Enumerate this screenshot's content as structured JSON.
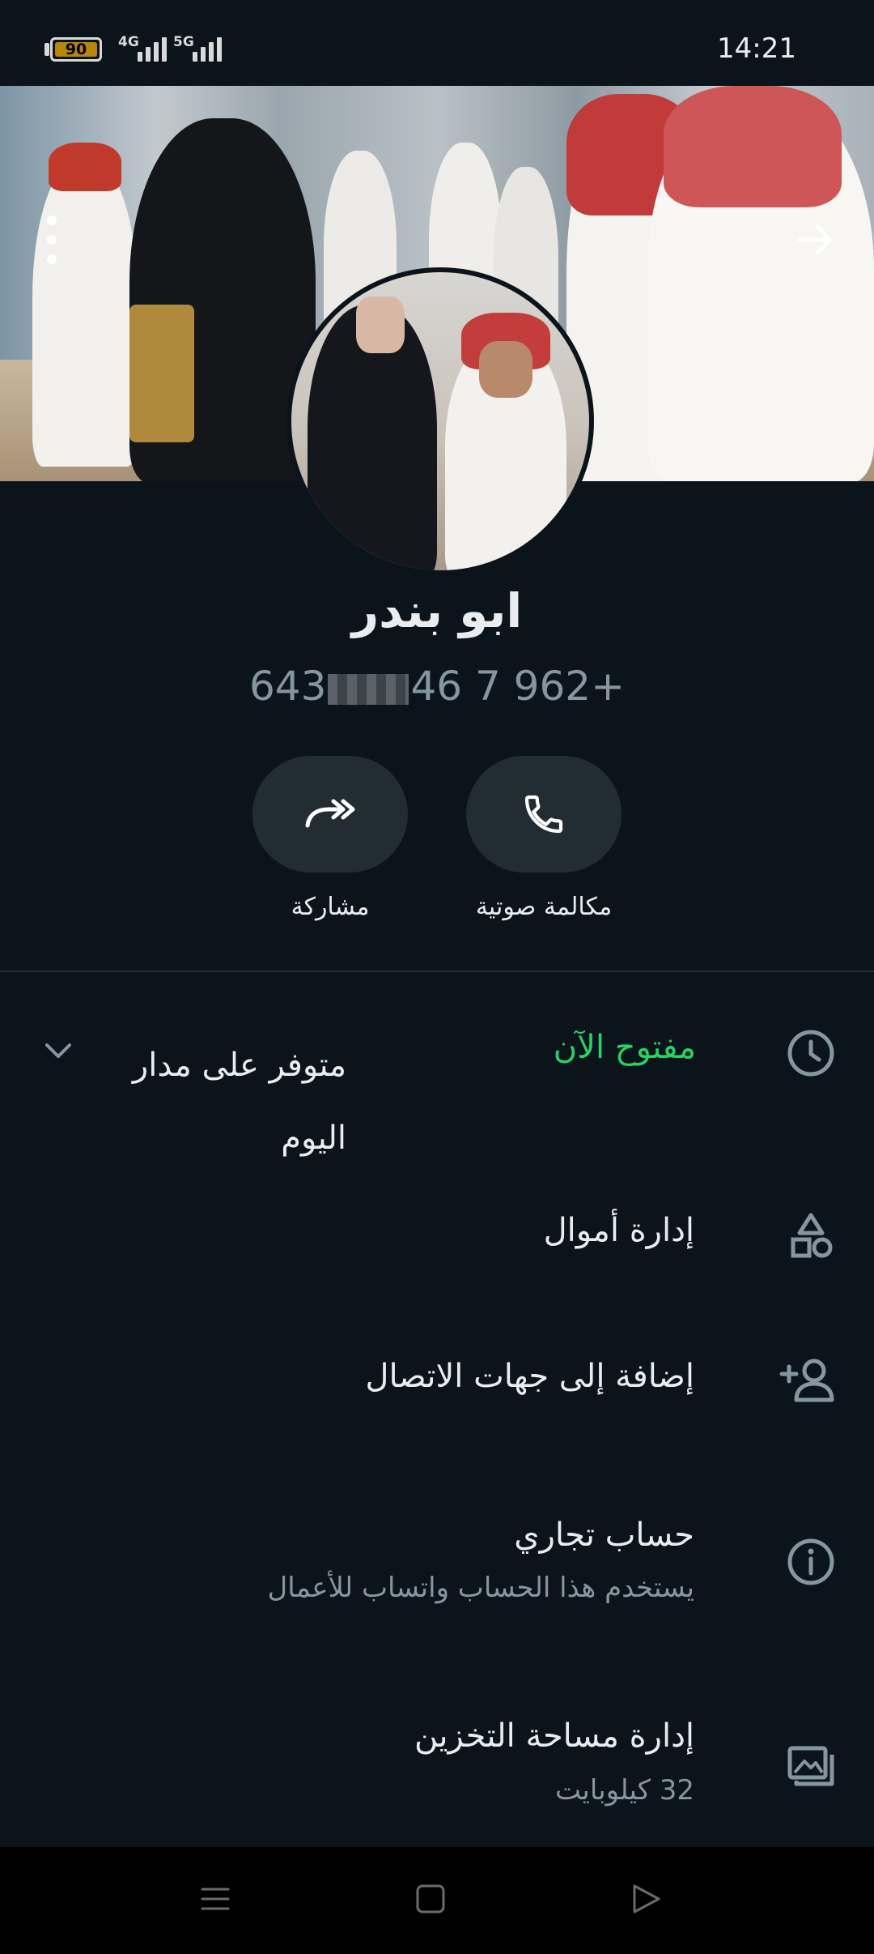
{
  "status_bar": {
    "battery": "90",
    "network_1": "4G",
    "network_2": "5G",
    "time": "14:21"
  },
  "header": {
    "menu_icon": "more-vertical-icon",
    "back_icon": "arrow-right-icon"
  },
  "profile": {
    "name": "ابو بندر",
    "phone_prefix": "643",
    "phone_suffix": "46 7 962+"
  },
  "actions": [
    {
      "label": "مشاركة",
      "icon": "share-icon"
    },
    {
      "label": "مكالمة صوتية",
      "icon": "phone-icon"
    }
  ],
  "hours": {
    "status": "مفتوح الآن",
    "status_color": "#25d366",
    "detail_line1": "متوفر على مدار",
    "detail_line2": "اليوم",
    "icon": "clock-icon"
  },
  "rows": [
    {
      "title": "إدارة أموال",
      "icon": "category-shapes-icon"
    },
    {
      "title": "إضافة إلى جهات الاتصال",
      "icon": "add-contact-icon"
    },
    {
      "title": "حساب تجاري",
      "subtitle": "يستخدم هذا الحساب واتساب للأعمال",
      "icon": "info-icon"
    },
    {
      "title": "إدارة مساحة التخزين",
      "subtitle": "32 كيلوبايت",
      "icon": "storage-icon"
    }
  ],
  "colors": {
    "background": "#0b141a",
    "accent": "#25d366",
    "secondary_text": "#8696a0"
  }
}
